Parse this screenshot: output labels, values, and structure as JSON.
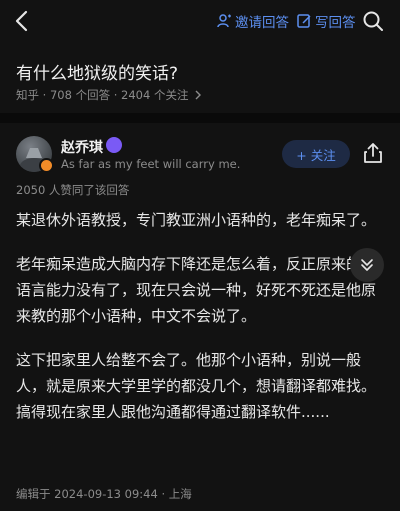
{
  "header": {
    "invite_label": "邀请回答",
    "write_label": "写回答"
  },
  "question": {
    "title": "有什么地狱级的笑话?",
    "meta": "知乎 · 708 个回答 · 2404 个关注"
  },
  "answer": {
    "author_name": "赵乔琪",
    "author_bio": "As far as my feet will carry me.",
    "follow_label": "+ 关注",
    "votes": "2050 人赞同了该回答",
    "paragraphs": [
      "某退休外语教授，专门教亚洲小语种的，老年痴呆了。",
      "老年痴呆造成大脑内存下降还是怎么着，反正原来的多语言能力没有了，现在只会说一种，好死不死还是他原来教的那个小语种，中文不会说了。",
      "这下把家里人给整不会了。他那个小语种，别说一般人，就是原来大学里学的都没几个，想请翻译都难找。搞得现在家里人跟他沟通都得通过翻译软件......"
    ],
    "edited": "编辑于 2024-09-13 09:44 · 上海"
  },
  "colors": {
    "background": "#121212",
    "accent": "#5c8ff0",
    "text_primary": "#e6e6e6",
    "text_secondary": "#8c8c8c"
  },
  "icons": [
    "back-arrow-icon",
    "invite-icon",
    "write-icon",
    "search-icon",
    "chevron-right-icon",
    "share-icon",
    "collapse-icon"
  ]
}
